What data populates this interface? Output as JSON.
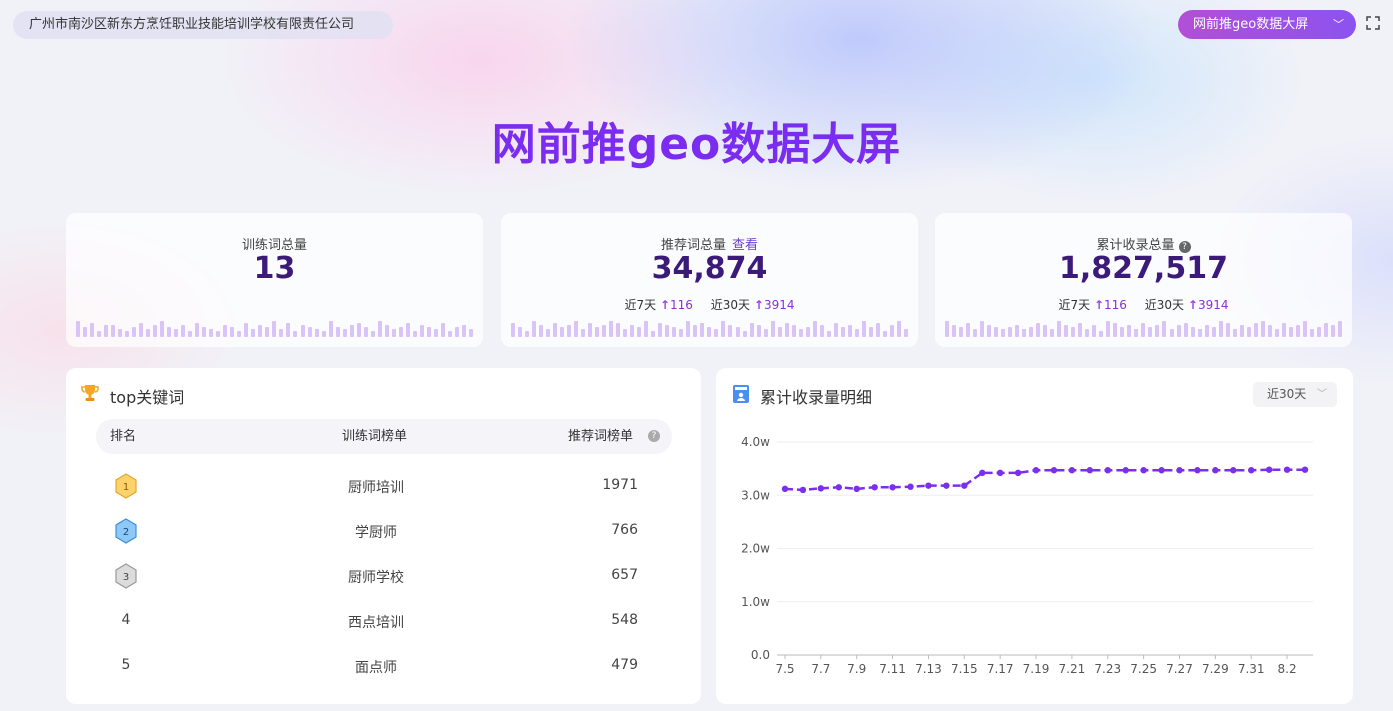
{
  "header": {
    "company": "广州市南沙区新东方烹饪职业技能培训学校有限责任公司",
    "screen_select": "网前推geo数据大屏",
    "title": "网前推geo数据大屏"
  },
  "stats": [
    {
      "label": "训练词总量",
      "value": "13",
      "bars": [
        0.8,
        0.5,
        0.7,
        0.3,
        0.6,
        0.6,
        0.4,
        0.3,
        0.5,
        0.7,
        0.4,
        0.6,
        0.8,
        0.5,
        0.4,
        0.6,
        0.3,
        0.7,
        0.5,
        0.4,
        0.3,
        0.6,
        0.5,
        0.3,
        0.7,
        0.4,
        0.6,
        0.5,
        0.8,
        0.4,
        0.7,
        0.3,
        0.6,
        0.5,
        0.4,
        0.3,
        0.8,
        0.5,
        0.4,
        0.6,
        0.7,
        0.5,
        0.3,
        0.8,
        0.6,
        0.4,
        0.5,
        0.7,
        0.3,
        0.6,
        0.5,
        0.4,
        0.7,
        0.3,
        0.5,
        0.6,
        0.4
      ]
    },
    {
      "label": "推荐词总量",
      "link": "查看",
      "value": "34,874",
      "trend": [
        {
          "label": "近7天",
          "value": "116"
        },
        {
          "label": "近30天",
          "value": "3914"
        }
      ],
      "bars": [
        0.7,
        0.5,
        0.3,
        0.8,
        0.6,
        0.4,
        0.7,
        0.5,
        0.6,
        0.8,
        0.4,
        0.7,
        0.5,
        0.6,
        0.8,
        0.7,
        0.4,
        0.6,
        0.5,
        0.8,
        0.3,
        0.7,
        0.6,
        0.5,
        0.4,
        0.8,
        0.6,
        0.7,
        0.5,
        0.4,
        0.8,
        0.6,
        0.5,
        0.3,
        0.7,
        0.6,
        0.4,
        0.8,
        0.5,
        0.7,
        0.6,
        0.4,
        0.5,
        0.8,
        0.6,
        0.3,
        0.7,
        0.5,
        0.6,
        0.4,
        0.8,
        0.5,
        0.7,
        0.3,
        0.6,
        0.8,
        0.4
      ]
    },
    {
      "label": "累计收录总量",
      "help": "?",
      "value": "1,827,517",
      "trend": [
        {
          "label": "近7天",
          "value": "116"
        },
        {
          "label": "近30天",
          "value": "3914"
        }
      ],
      "bars": [
        0.8,
        0.6,
        0.5,
        0.7,
        0.4,
        0.8,
        0.6,
        0.5,
        0.4,
        0.5,
        0.6,
        0.4,
        0.5,
        0.7,
        0.6,
        0.4,
        0.8,
        0.6,
        0.5,
        0.7,
        0.4,
        0.6,
        0.3,
        0.8,
        0.7,
        0.5,
        0.6,
        0.4,
        0.7,
        0.5,
        0.6,
        0.8,
        0.4,
        0.6,
        0.7,
        0.5,
        0.4,
        0.6,
        0.5,
        0.8,
        0.7,
        0.4,
        0.6,
        0.5,
        0.7,
        0.8,
        0.6,
        0.4,
        0.7,
        0.5,
        0.6,
        0.8,
        0.4,
        0.5,
        0.7,
        0.6,
        0.8
      ]
    }
  ],
  "top_keywords": {
    "title": "top关键词",
    "headers": {
      "rank": "排名",
      "train": "训练词榜单",
      "recommend": "推荐词榜单"
    },
    "rows": [
      {
        "rank": "1",
        "keyword": "厨师培训",
        "count": "1971"
      },
      {
        "rank": "2",
        "keyword": "学厨师",
        "count": "766"
      },
      {
        "rank": "3",
        "keyword": "厨师学校",
        "count": "657"
      },
      {
        "rank": "4",
        "keyword": "西点培训",
        "count": "548"
      },
      {
        "rank": "5",
        "keyword": "面点师",
        "count": "479"
      }
    ]
  },
  "detail_panel": {
    "title": "累计收录量明细",
    "range": "近30天"
  },
  "colors": {
    "accent": "#7a2cf0",
    "line": "#7b2ef0",
    "value_dark": "#3b1a7a",
    "bar": "#d9c3f7"
  },
  "chart_data": {
    "type": "line",
    "x": [
      "7.5",
      "7.6",
      "7.7",
      "7.8",
      "7.9",
      "7.10",
      "7.11",
      "7.12",
      "7.13",
      "7.14",
      "7.15",
      "7.16",
      "7.17",
      "7.18",
      "7.19",
      "7.20",
      "7.21",
      "7.22",
      "7.23",
      "7.24",
      "7.25",
      "7.26",
      "7.27",
      "7.28",
      "7.29",
      "7.30",
      "7.31",
      "8.1",
      "8.2",
      "8.3"
    ],
    "x_ticks": [
      "7.5",
      "7.7",
      "7.9",
      "7.11",
      "7.13",
      "7.15",
      "7.17",
      "7.19",
      "7.21",
      "7.23",
      "7.25",
      "7.27",
      "7.29",
      "7.31",
      "8.2"
    ],
    "values": [
      3.12,
      3.1,
      3.13,
      3.15,
      3.12,
      3.15,
      3.15,
      3.16,
      3.18,
      3.18,
      3.18,
      3.42,
      3.42,
      3.42,
      3.47,
      3.47,
      3.47,
      3.47,
      3.47,
      3.47,
      3.47,
      3.47,
      3.47,
      3.47,
      3.47,
      3.47,
      3.47,
      3.48,
      3.48,
      3.48
    ],
    "y_ticks": [
      "0.0",
      "1.0w",
      "2.0w",
      "3.0w",
      "4.0w"
    ],
    "ylim": [
      0,
      4
    ],
    "grid": true
  }
}
